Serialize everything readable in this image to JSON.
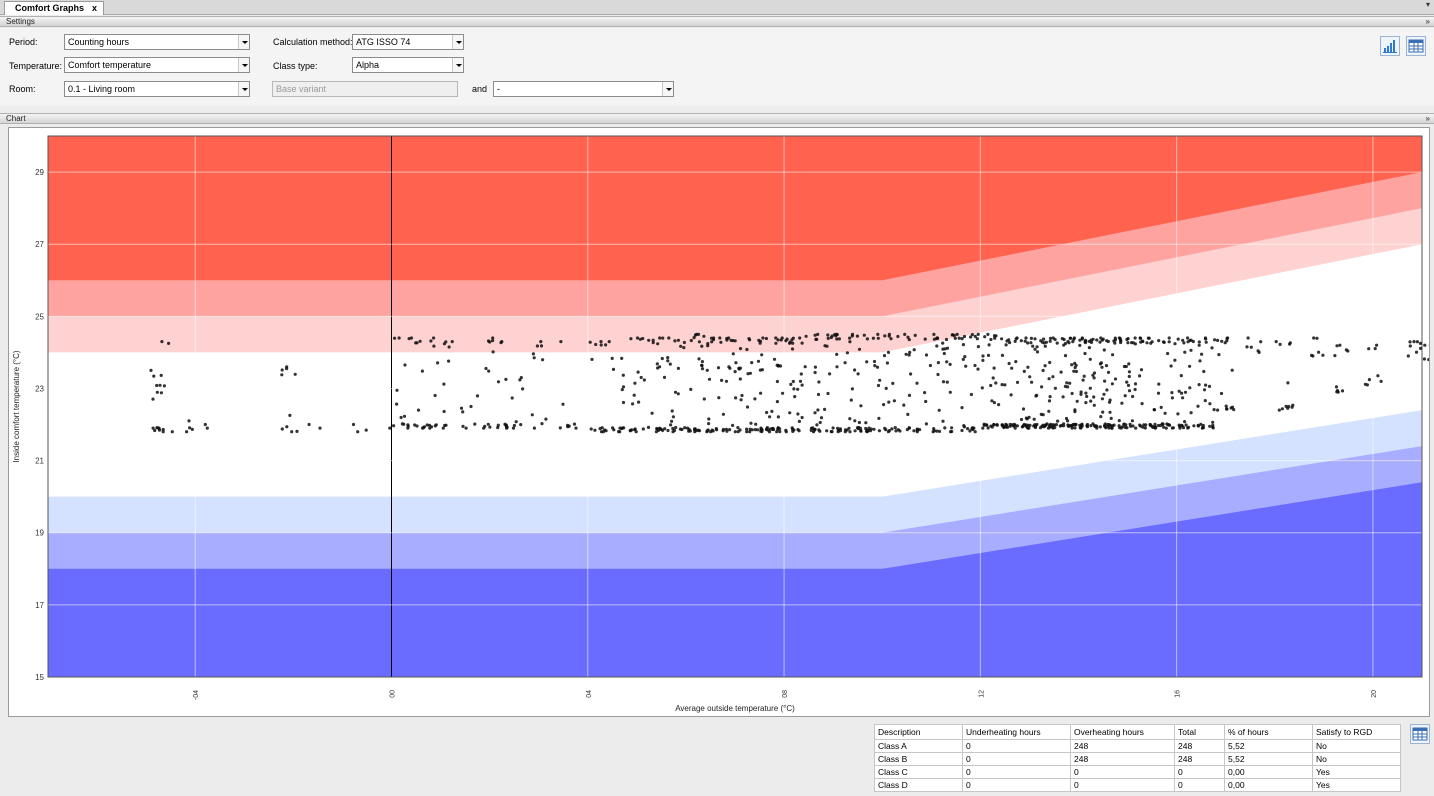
{
  "tab": {
    "title": "Comfort Graphs",
    "close": "x"
  },
  "settings": {
    "header": "Settings",
    "period_label": "Period:",
    "period_value": "Counting hours",
    "temperature_label": "Temperature:",
    "temperature_value": "Comfort temperature",
    "room_label": "Room:",
    "room_value": "0.1 - Living room",
    "calc_label": "Calculation method:",
    "calc_value": "ATG ISSO 74",
    "class_label": "Class type:",
    "class_value": "Alpha",
    "variant_placeholder": "Base variant",
    "and_label": "and",
    "compare_value": "-"
  },
  "chart_section": {
    "header": "Chart"
  },
  "chart_data": {
    "type": "scatter",
    "xlabel": "Average outside temperature (°C)",
    "ylabel": "Inside comfort temperature (°C)",
    "xlim": [
      -7,
      21
    ],
    "ylim": [
      15,
      30
    ],
    "x_ticks": [
      -4,
      0,
      4,
      8,
      12,
      16,
      20
    ],
    "x_tick_labels": [
      "-04",
      "00",
      "04",
      "08",
      "12",
      "16",
      "20"
    ],
    "y_ticks": [
      17,
      19,
      21,
      23,
      25,
      27,
      29
    ],
    "grid": true,
    "comfort_bands": {
      "knee_x": 10,
      "upper_limits": [
        {
          "flat": 26,
          "end": 29
        },
        {
          "flat": 25,
          "end": 28
        },
        {
          "flat": 24,
          "end": 27
        }
      ],
      "lower_limits": [
        {
          "flat": 20,
          "end": 22.4
        },
        {
          "flat": 19,
          "end": 21.4
        },
        {
          "flat": 18,
          "end": 20.4
        }
      ],
      "colors": [
        "#ff6350",
        "#ffa3a0",
        "#ffd2d2",
        "#ffffff",
        "#d4e2ff",
        "#a8adff",
        "#6a6cff"
      ]
    },
    "scatter_summary": "hourly points, y approx 21.8 to 24.5",
    "columns": [
      {
        "x": -4.8,
        "ymin": 21.8,
        "ymax": 23.5,
        "n": 14
      },
      {
        "x": -4.6,
        "ymin": 21.8,
        "ymax": 24.3,
        "n": 6
      },
      {
        "x": -4.1,
        "ymin": 21.8,
        "ymax": 22.1,
        "n": 4
      },
      {
        "x": -3.8,
        "ymin": 21.9,
        "ymax": 22.0,
        "n": 2
      },
      {
        "x": -2.1,
        "ymin": 21.8,
        "ymax": 23.6,
        "n": 10
      },
      {
        "x": -1.6,
        "ymin": 21.9,
        "ymax": 22.0,
        "n": 2
      },
      {
        "x": -0.6,
        "ymin": 21.8,
        "ymax": 22.0,
        "n": 3
      },
      {
        "x": -0.1,
        "ymin": 21.9,
        "ymax": 21.9,
        "n": 1
      },
      {
        "x": 0.2,
        "ymin": 21.9,
        "ymax": 24.4,
        "n": 14
      },
      {
        "x": 0.5,
        "ymin": 21.9,
        "ymax": 24.4,
        "n": 10
      },
      {
        "x": 0.8,
        "ymin": 21.9,
        "ymax": 24.4,
        "n": 12
      },
      {
        "x": 1.2,
        "ymin": 21.9,
        "ymax": 24.3,
        "n": 10
      },
      {
        "x": 1.6,
        "ymin": 21.9,
        "ymax": 22.5,
        "n": 6
      },
      {
        "x": 1.9,
        "ymin": 21.9,
        "ymax": 24.4,
        "n": 12
      },
      {
        "x": 2.2,
        "ymin": 21.9,
        "ymax": 24.3,
        "n": 12
      },
      {
        "x": 2.6,
        "ymin": 21.9,
        "ymax": 23.3,
        "n": 8
      },
      {
        "x": 3.0,
        "ymin": 21.9,
        "ymax": 24.3,
        "n": 10
      },
      {
        "x": 3.6,
        "ymin": 21.9,
        "ymax": 24.3,
        "n": 8
      },
      {
        "x": 4.2,
        "ymin": 21.8,
        "ymax": 24.3,
        "n": 14
      },
      {
        "x": 4.6,
        "ymin": 21.8,
        "ymax": 24.3,
        "n": 16
      },
      {
        "x": 5.0,
        "ymin": 21.8,
        "ymax": 24.4,
        "n": 18
      },
      {
        "x": 5.4,
        "ymin": 21.8,
        "ymax": 24.4,
        "n": 22
      },
      {
        "x": 5.8,
        "ymin": 21.8,
        "ymax": 24.4,
        "n": 24
      },
      {
        "x": 6.2,
        "ymin": 21.8,
        "ymax": 24.5,
        "n": 26
      },
      {
        "x": 6.6,
        "ymin": 21.8,
        "ymax": 24.4,
        "n": 26
      },
      {
        "x": 7.0,
        "ymin": 21.8,
        "ymax": 24.4,
        "n": 28
      },
      {
        "x": 7.4,
        "ymin": 21.8,
        "ymax": 24.4,
        "n": 32
      },
      {
        "x": 7.8,
        "ymin": 21.8,
        "ymax": 24.4,
        "n": 34
      },
      {
        "x": 8.2,
        "ymin": 21.8,
        "ymax": 24.4,
        "n": 30
      },
      {
        "x": 8.6,
        "ymin": 21.8,
        "ymax": 24.5,
        "n": 24
      },
      {
        "x": 9.0,
        "ymin": 21.8,
        "ymax": 24.5,
        "n": 26
      },
      {
        "x": 9.4,
        "ymin": 21.8,
        "ymax": 24.5,
        "n": 28
      },
      {
        "x": 9.8,
        "ymin": 21.8,
        "ymax": 24.5,
        "n": 24
      },
      {
        "x": 10.2,
        "ymin": 21.8,
        "ymax": 24.5,
        "n": 22
      },
      {
        "x": 10.6,
        "ymin": 21.8,
        "ymax": 24.5,
        "n": 22
      },
      {
        "x": 11.0,
        "ymin": 21.8,
        "ymax": 24.5,
        "n": 20
      },
      {
        "x": 11.4,
        "ymin": 21.8,
        "ymax": 24.5,
        "n": 22
      },
      {
        "x": 11.8,
        "ymin": 21.8,
        "ymax": 24.5,
        "n": 26
      },
      {
        "x": 12.2,
        "ymin": 21.9,
        "ymax": 24.5,
        "n": 30
      },
      {
        "x": 12.6,
        "ymin": 21.9,
        "ymax": 24.4,
        "n": 34
      },
      {
        "x": 13.0,
        "ymin": 21.9,
        "ymax": 24.4,
        "n": 40
      },
      {
        "x": 13.4,
        "ymin": 21.9,
        "ymax": 24.4,
        "n": 44
      },
      {
        "x": 13.8,
        "ymin": 21.9,
        "ymax": 24.4,
        "n": 46
      },
      {
        "x": 14.2,
        "ymin": 21.9,
        "ymax": 24.4,
        "n": 48
      },
      {
        "x": 14.6,
        "ymin": 21.9,
        "ymax": 24.4,
        "n": 44
      },
      {
        "x": 15.0,
        "ymin": 21.9,
        "ymax": 24.4,
        "n": 40
      },
      {
        "x": 15.4,
        "ymin": 21.9,
        "ymax": 24.4,
        "n": 30
      },
      {
        "x": 15.8,
        "ymin": 21.9,
        "ymax": 24.4,
        "n": 28
      },
      {
        "x": 16.2,
        "ymin": 21.9,
        "ymax": 24.4,
        "n": 30
      },
      {
        "x": 16.6,
        "ymin": 21.9,
        "ymax": 24.4,
        "n": 30
      },
      {
        "x": 17.0,
        "ymin": 22.4,
        "ymax": 24.4,
        "n": 16
      },
      {
        "x": 17.6,
        "ymin": 24.0,
        "ymax": 24.4,
        "n": 6
      },
      {
        "x": 18.2,
        "ymin": 22.4,
        "ymax": 24.3,
        "n": 12
      },
      {
        "x": 18.9,
        "ymin": 23.9,
        "ymax": 24.4,
        "n": 6
      },
      {
        "x": 19.4,
        "ymin": 22.9,
        "ymax": 24.2,
        "n": 10
      },
      {
        "x": 20.0,
        "ymin": 23.1,
        "ymax": 24.2,
        "n": 8
      },
      {
        "x": 20.8,
        "ymin": 23.9,
        "ymax": 24.3,
        "n": 8
      },
      {
        "x": 21.2,
        "ymin": 23.8,
        "ymax": 24.2,
        "n": 8
      }
    ]
  },
  "results": {
    "headers": [
      "Description",
      "Underheating hours",
      "Overheating hours",
      "Total",
      "% of hours",
      "Satisfy to RGD"
    ],
    "rows": [
      [
        "Class A",
        "0",
        "248",
        "248",
        "5,52",
        "No"
      ],
      [
        "Class B",
        "0",
        "248",
        "248",
        "5,52",
        "No"
      ],
      [
        "Class C",
        "0",
        "0",
        "0",
        "0,00",
        "Yes"
      ],
      [
        "Class D",
        "0",
        "0",
        "0",
        "0,00",
        "Yes"
      ]
    ]
  }
}
